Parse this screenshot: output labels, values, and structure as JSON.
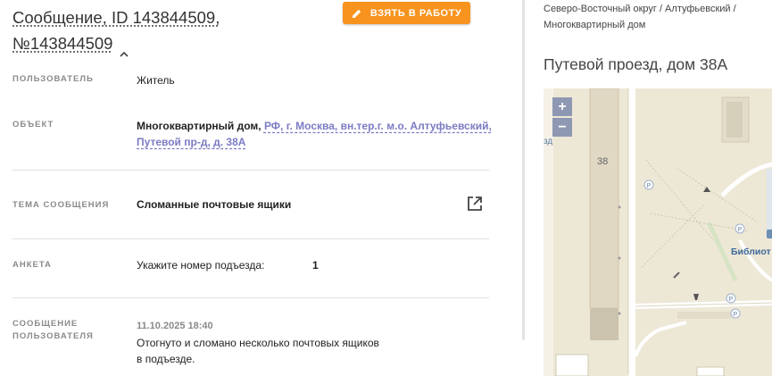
{
  "message": {
    "title_line1": "Сообщение, ID 143844509,",
    "title_line2": "№143844509",
    "take_button": "ВЗЯТЬ В РАБОТУ"
  },
  "fields": {
    "user_label": "ПОЛЬЗОВАТЕЛЬ",
    "user_value": "Житель",
    "object_label": "ОБЪЕКТ",
    "object_type": "Многоквартирный дом,",
    "object_address_line1": "РФ, г. Москва, вн.тер.г. м.о. Алтуфьевский,",
    "object_address_line2": "Путевой пр-д, д. 38А",
    "topic_label": "ТЕМА СООБЩЕНИЯ",
    "topic_value": "Сломанные почтовые ящики",
    "survey_label": "АНКЕТА",
    "survey_question": "Укажите номер подъезда:",
    "survey_answer": "1",
    "user_message_label_line1": "СООБЩЕНИЕ",
    "user_message_label_line2": "ПОЛЬЗОВАТЕЛЯ",
    "user_message_date": "11.10.2025 18:40",
    "user_message_text_line1": "Отогнуто и сломано несколько почтовых ящиков",
    "user_message_text_line2": "в подъезде."
  },
  "location": {
    "breadcrumb_line1": "Северо-Восточный округ / Алтуфьевский /",
    "breadcrumb_line2": "Многоквартирный дом",
    "address": "Путевой проезд, дом 38А"
  },
  "map": {
    "zoom_in": "+",
    "zoom_out": "−",
    "building_number": "38",
    "road_label_fragment": "зд",
    "library_label": "Библиот"
  },
  "colors": {
    "accent": "#f7931e",
    "link": "#7b7bc4",
    "map_background": "#ede7d6"
  }
}
